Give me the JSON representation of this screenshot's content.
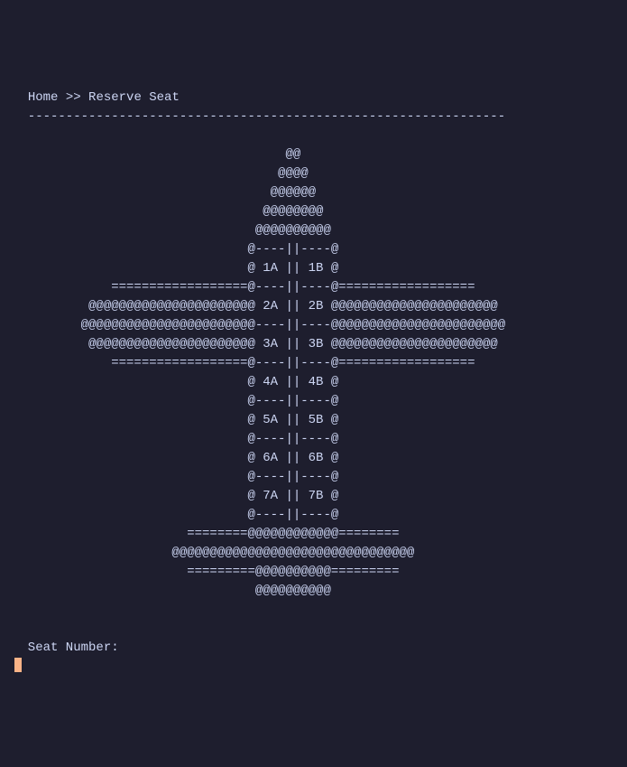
{
  "breadcrumb": {
    "home": "Home",
    "sep": ">>",
    "current": "Reserve Seat"
  },
  "divider": "  ---------------------------------------------------------------",
  "plane": [
    "                                    @@",
    "                                   @@@@",
    "                                  @@@@@@",
    "                                 @@@@@@@@",
    "                                @@@@@@@@@@",
    "                               @----||----@",
    "                               @ 1A || 1B @",
    "             ==================@----||----@==================",
    "          @@@@@@@@@@@@@@@@@@@@@@ 2A || 2B @@@@@@@@@@@@@@@@@@@@@@",
    "         @@@@@@@@@@@@@@@@@@@@@@@----||----@@@@@@@@@@@@@@@@@@@@@@@",
    "          @@@@@@@@@@@@@@@@@@@@@@ 3A || 3B @@@@@@@@@@@@@@@@@@@@@@",
    "             ==================@----||----@==================",
    "                               @ 4A || 4B @",
    "                               @----||----@",
    "                               @ 5A || 5B @",
    "                               @----||----@",
    "                               @ 6A || 6B @",
    "                               @----||----@",
    "                               @ 7A || 7B @",
    "                               @----||----@",
    "                       ========@@@@@@@@@@@@========",
    "                     @@@@@@@@@@@@@@@@@@@@@@@@@@@@@@@@",
    "                       =========@@@@@@@@@@=========",
    "                                @@@@@@@@@@"
  ],
  "prompt": {
    "label": "  Seat Number:",
    "value": ""
  },
  "seats": {
    "rows": [
      1,
      2,
      3,
      4,
      5,
      6,
      7
    ],
    "columns": [
      "A",
      "B"
    ]
  }
}
